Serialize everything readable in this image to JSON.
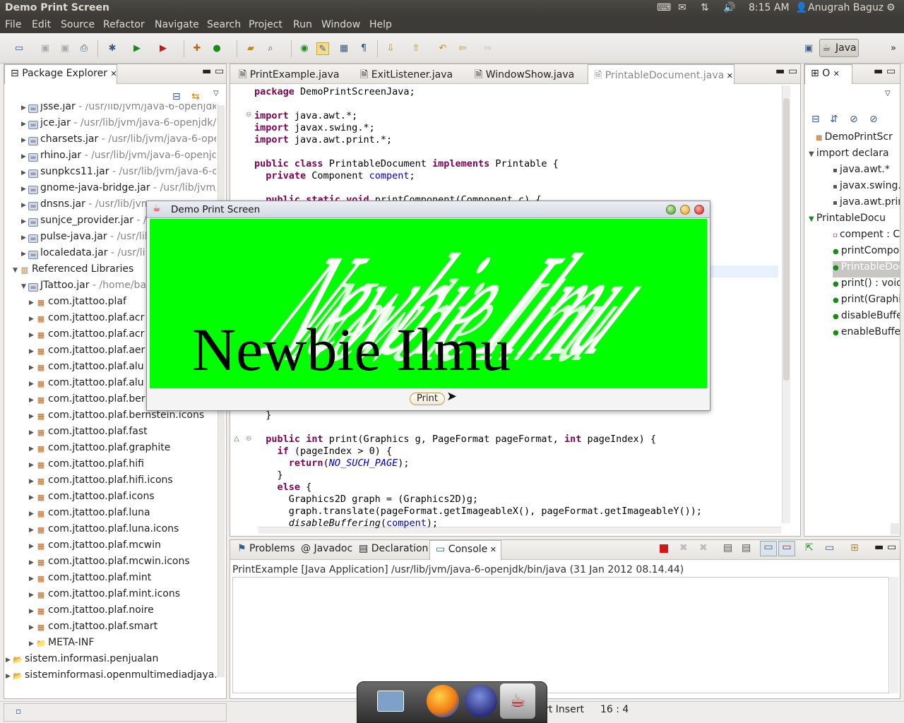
{
  "topbar": {
    "title": "Demo Print Screen",
    "time": "8:15 AM",
    "user": "Anugrah Baguz",
    "icons": [
      "keyboard-icon",
      "mail-icon",
      "network-icon",
      "volume-icon",
      "user-icon",
      "settings-icon"
    ]
  },
  "menu": [
    "File",
    "Edit",
    "Source",
    "Refactor",
    "Navigate",
    "Search",
    "Project",
    "Run",
    "Window",
    "Help"
  ],
  "toolbar": {
    "perspective_label": "Java"
  },
  "package_explorer": {
    "title": "Package Explorer",
    "rows": [
      {
        "name": "jsse.jar",
        "path": " - /usr/lib/jvm/java-6-openjdk"
      },
      {
        "name": "jce.jar",
        "path": " - /usr/lib/jvm/java-6-openjdk/j"
      },
      {
        "name": "charsets.jar",
        "path": " - /usr/lib/jvm/java-6-ope"
      },
      {
        "name": "rhino.jar",
        "path": " - /usr/lib/jvm/java-6-openjd"
      },
      {
        "name": "sunpkcs11.jar",
        "path": " - /usr/lib/jvm/java-6-op"
      },
      {
        "name": "gnome-java-bridge.jar",
        "path": " - /usr/lib/jvm/"
      },
      {
        "name": "dnsns.jar",
        "path": " - /usr/lib/jvm"
      },
      {
        "name": "sunjce_provider.jar",
        "path": " - /"
      },
      {
        "name": "pulse-java.jar",
        "path": " - /usr/lib"
      },
      {
        "name": "localedata.jar",
        "path": " - /usr/li"
      }
    ],
    "referenced_libraries": "Referenced Libraries",
    "jtattoo": {
      "name": "JTattoo.jar",
      "path": " - /home/ba"
    },
    "packages": [
      "com.jtattoo.plaf",
      "com.jtattoo.plaf.acr",
      "com.jtattoo.plaf.acr",
      "com.jtattoo.plaf.aer",
      "com.jtattoo.plaf.alu",
      "com.jtattoo.plaf.alu",
      "com.jtattoo.plaf.ber",
      "com.jtattoo.plaf.bernstein.icons",
      "com.jtattoo.plaf.fast",
      "com.jtattoo.plaf.graphite",
      "com.jtattoo.plaf.hifi",
      "com.jtattoo.plaf.hifi.icons",
      "com.jtattoo.plaf.icons",
      "com.jtattoo.plaf.luna",
      "com.jtattoo.plaf.luna.icons",
      "com.jtattoo.plaf.mcwin",
      "com.jtattoo.plaf.mcwin.icons",
      "com.jtattoo.plaf.mint",
      "com.jtattoo.plaf.mint.icons",
      "com.jtattoo.plaf.noire",
      "com.jtattoo.plaf.smart"
    ],
    "meta_inf": "META-INF",
    "projects": [
      "sistem.informasi.penjualan",
      "sisteminformasi.openmultimediadjaya."
    ]
  },
  "editor": {
    "tabs": [
      "PrintExample.java",
      "ExitListener.java",
      "WindowShow.java",
      "PrintableDocument.java"
    ],
    "lines_top": [
      "package DemoPrintScreenJava;",
      "",
      "import java.awt.*;",
      "import javax.swing.*;",
      "import java.awt.print.*;",
      "",
      "public class PrintableDocument implements Printable {",
      "  private Component compent;",
      "",
      "  public static void printComponent(Component c) {"
    ],
    "lines_bottom": [
      "  }",
      "",
      "  public int print(Graphics g, PageFormat pageFormat, int pageIndex) {",
      "    if (pageIndex > 0) {",
      "      return(NO_SUCH_PAGE);",
      "    }",
      "    else {",
      "      Graphics2D graph = (Graphics2D)g;",
      "      graph.translate(pageFormat.getImageableX(), pageFormat.getImageableY());",
      "      disableBuffering(compent);"
    ]
  },
  "outline": {
    "title": "O",
    "items": [
      "DemoPrintScr",
      "import declara",
      "java.awt.*",
      "javax.swing.*",
      "java.awt.prin",
      "PrintableDocu",
      "compent : Co",
      "printCompon",
      "PrintableDoc",
      "print() : void",
      "print(Graphi",
      "disableBuffe",
      "enableBuffer"
    ]
  },
  "bottom": {
    "tabs": [
      "Problems",
      "Javadoc",
      "Declaration",
      "Console"
    ],
    "console_header": "PrintExample [Java Application] /usr/lib/jvm/java-6-openjdk/bin/java (31 Jan 2012 08.14.44)"
  },
  "status": {
    "mode": "Smart Insert",
    "position": "16 : 4"
  },
  "dialog": {
    "title": "Demo Print Screen",
    "big_text": "Newbie Ilmu",
    "print_label": "Print"
  },
  "colors": {
    "canvas": "#00ff00",
    "keyword": "#7f0055",
    "field": "#0000c0"
  }
}
